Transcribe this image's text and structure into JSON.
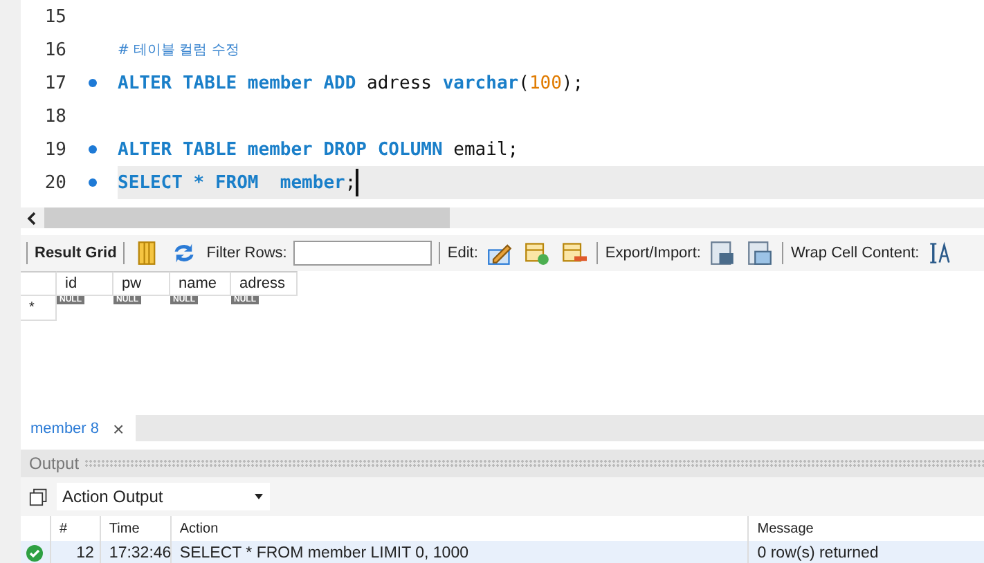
{
  "editor": {
    "lines": [
      {
        "number": "15",
        "marked": false,
        "current": false
      },
      {
        "number": "16",
        "marked": false,
        "current": false,
        "tokens": [
          {
            "kind": "comment",
            "text": "# 테이블 컬럼 수정"
          }
        ]
      },
      {
        "number": "17",
        "marked": true,
        "current": false,
        "tokens": [
          {
            "kind": "keyword",
            "text": "ALTER TABLE member ADD"
          },
          {
            "kind": "plain",
            "text": " adress "
          },
          {
            "kind": "keyword",
            "text": "varchar"
          },
          {
            "kind": "plain",
            "text": "("
          },
          {
            "kind": "number",
            "text": "100"
          },
          {
            "kind": "plain",
            "text": ");"
          }
        ]
      },
      {
        "number": "18",
        "marked": false,
        "current": false
      },
      {
        "number": "19",
        "marked": true,
        "current": false,
        "tokens": [
          {
            "kind": "keyword",
            "text": "ALTER TABLE member DROP COLUMN"
          },
          {
            "kind": "plain",
            "text": " email;"
          }
        ]
      },
      {
        "number": "20",
        "marked": true,
        "current": true,
        "tokens": [
          {
            "kind": "keyword",
            "text": "SELECT * FROM  member"
          },
          {
            "kind": "plain",
            "text": ";"
          }
        ]
      }
    ]
  },
  "result_toolbar": {
    "title": "Result Grid",
    "filter_label": "Filter Rows:",
    "edit_label": "Edit:",
    "export_label": "Export/Import:",
    "wrap_label": "Wrap Cell Content:"
  },
  "result_grid": {
    "columns": [
      "id",
      "pw",
      "name",
      "adress"
    ],
    "new_row_marker": "*",
    "cells": [
      "NULL",
      "NULL",
      "NULL",
      "NULL"
    ]
  },
  "result_tab": {
    "label": "member 8",
    "close": "×"
  },
  "output": {
    "title": "Output",
    "selector": "Action Output",
    "columns": [
      "#",
      "Time",
      "Action",
      "Message"
    ],
    "rows": [
      {
        "succeeded": true,
        "number": "12",
        "time": "17:32:46",
        "action": "SELECT * FROM member LIMIT 0, 1000",
        "message": "0 row(s) returned"
      }
    ]
  }
}
